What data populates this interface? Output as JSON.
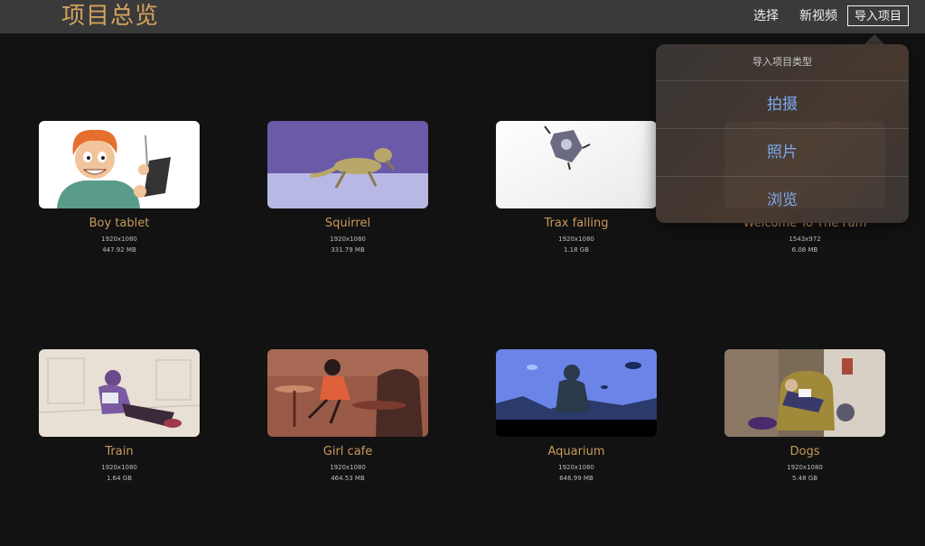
{
  "header": {
    "title": "项目总览",
    "select_label": "选择",
    "new_video_label": "新视频",
    "import_label": "导入项目"
  },
  "import_menu": {
    "title": "导入项目类型",
    "items": [
      "拍摄",
      "照片",
      "浏览"
    ]
  },
  "projects": [
    {
      "name": "Boy tablet",
      "resolution": "1920x1080",
      "size": "447.92 MB"
    },
    {
      "name": "Squirrel",
      "resolution": "1920x1080",
      "size": "331.79 MB"
    },
    {
      "name": "Trax falling",
      "resolution": "1920x1080",
      "size": "1.18 GB"
    },
    {
      "name": "Welcome To The Fam",
      "resolution": "1543x972",
      "size": "6.08 MB"
    },
    {
      "name": "Train",
      "resolution": "1920x1080",
      "size": "1.64 GB"
    },
    {
      "name": "Girl cafe",
      "resolution": "1920x1080",
      "size": "464.53 MB"
    },
    {
      "name": "Aquarium",
      "resolution": "1920x1080",
      "size": "646.99 MB"
    },
    {
      "name": "Dogs",
      "resolution": "1920x1080",
      "size": "5.48 GB"
    }
  ],
  "colors": {
    "accent": "#d3a25c",
    "menu_item": "#7fa8f0",
    "header_bg": "#3a3a3a",
    "page_bg": "#121212"
  }
}
